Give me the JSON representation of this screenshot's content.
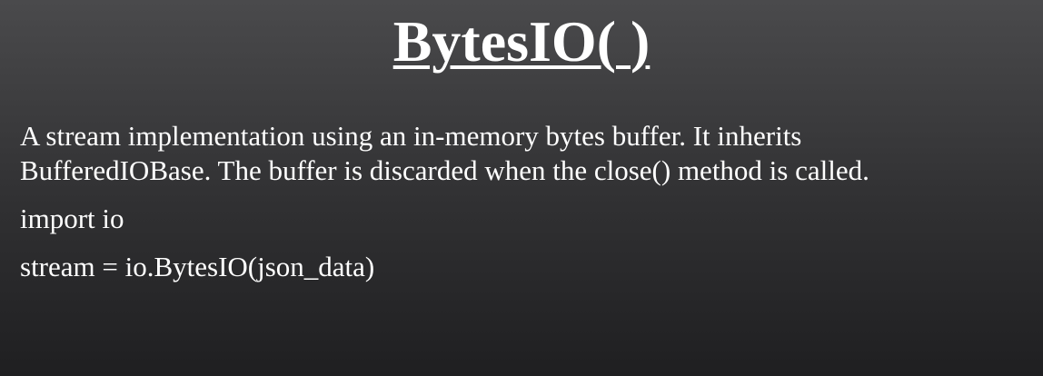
{
  "slide": {
    "title": "BytesIO( )",
    "description_lines": [
      "A stream implementation using an in-memory bytes buffer. It inherits",
      "BufferedIOBase. The buffer is discarded when the close() method is called."
    ],
    "code_lines": [
      "import io",
      "stream = io.BytesIO(json_data)"
    ]
  }
}
